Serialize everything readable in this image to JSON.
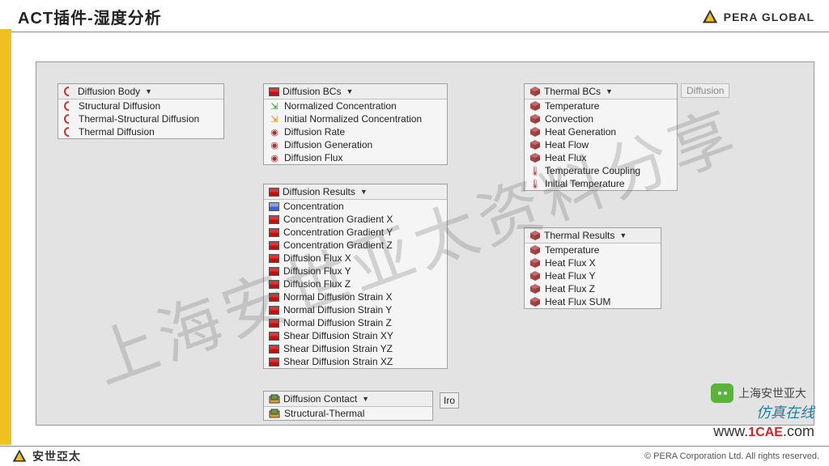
{
  "header": {
    "title": "ACT插件-湿度分析",
    "brand": "PERA GLOBAL"
  },
  "footer": {
    "brand_cn": "安世亞太",
    "copyright": "©  PERA Corporation Ltd. All rights reserved.",
    "cn_tagline": "仿真在线",
    "url_prefix": "www.",
    "url_mid": "1CAE",
    "url_suffix": ".com"
  },
  "wechat_label": "上海安世亚大",
  "watermark": "上海安世亚太资料分享",
  "menus": {
    "diffusion_body": {
      "title": "Diffusion Body",
      "items": [
        "Structural Diffusion",
        "Thermal-Structural Diffusion",
        "Thermal Diffusion"
      ]
    },
    "diffusion_bcs": {
      "title": "Diffusion BCs",
      "items": [
        "Normalized Concentration",
        "Initial Normalized Concentration",
        "Diffusion Rate",
        "Diffusion Generation",
        "Diffusion Flux"
      ]
    },
    "diffusion_results": {
      "title": "Diffusion Results",
      "items": [
        "Concentration",
        "Concentration Gradient X",
        "Concentration Gradient Y",
        "Concentration Gradient Z",
        "Diffusion Flux X",
        "Diffusion Flux Y",
        "Diffusion Flux Z",
        "Normal Diffusion Strain X",
        "Normal Diffusion Strain Y",
        "Normal Diffusion Strain Z",
        "Shear Diffusion Strain XY",
        "Shear Diffusion Strain YZ",
        "Shear Diffusion Strain XZ"
      ]
    },
    "thermal_bcs": {
      "title": "Thermal BCs",
      "items": [
        "Temperature",
        "Convection",
        "Heat Generation",
        "Heat Flow",
        "Heat Flux",
        "Temperature Coupling",
        "Initial Temperature"
      ]
    },
    "thermal_results": {
      "title": "Thermal Results",
      "items": [
        "Temperature",
        "Heat Flux X",
        "Heat Flux Y",
        "Heat Flux Z",
        "Heat Flux SUM"
      ]
    },
    "diffusion_contact": {
      "title": "Diffusion Contact",
      "items": [
        "Structural-Thermal"
      ],
      "trailing": "Iro"
    },
    "diffusion_tag": "Diffusion"
  }
}
